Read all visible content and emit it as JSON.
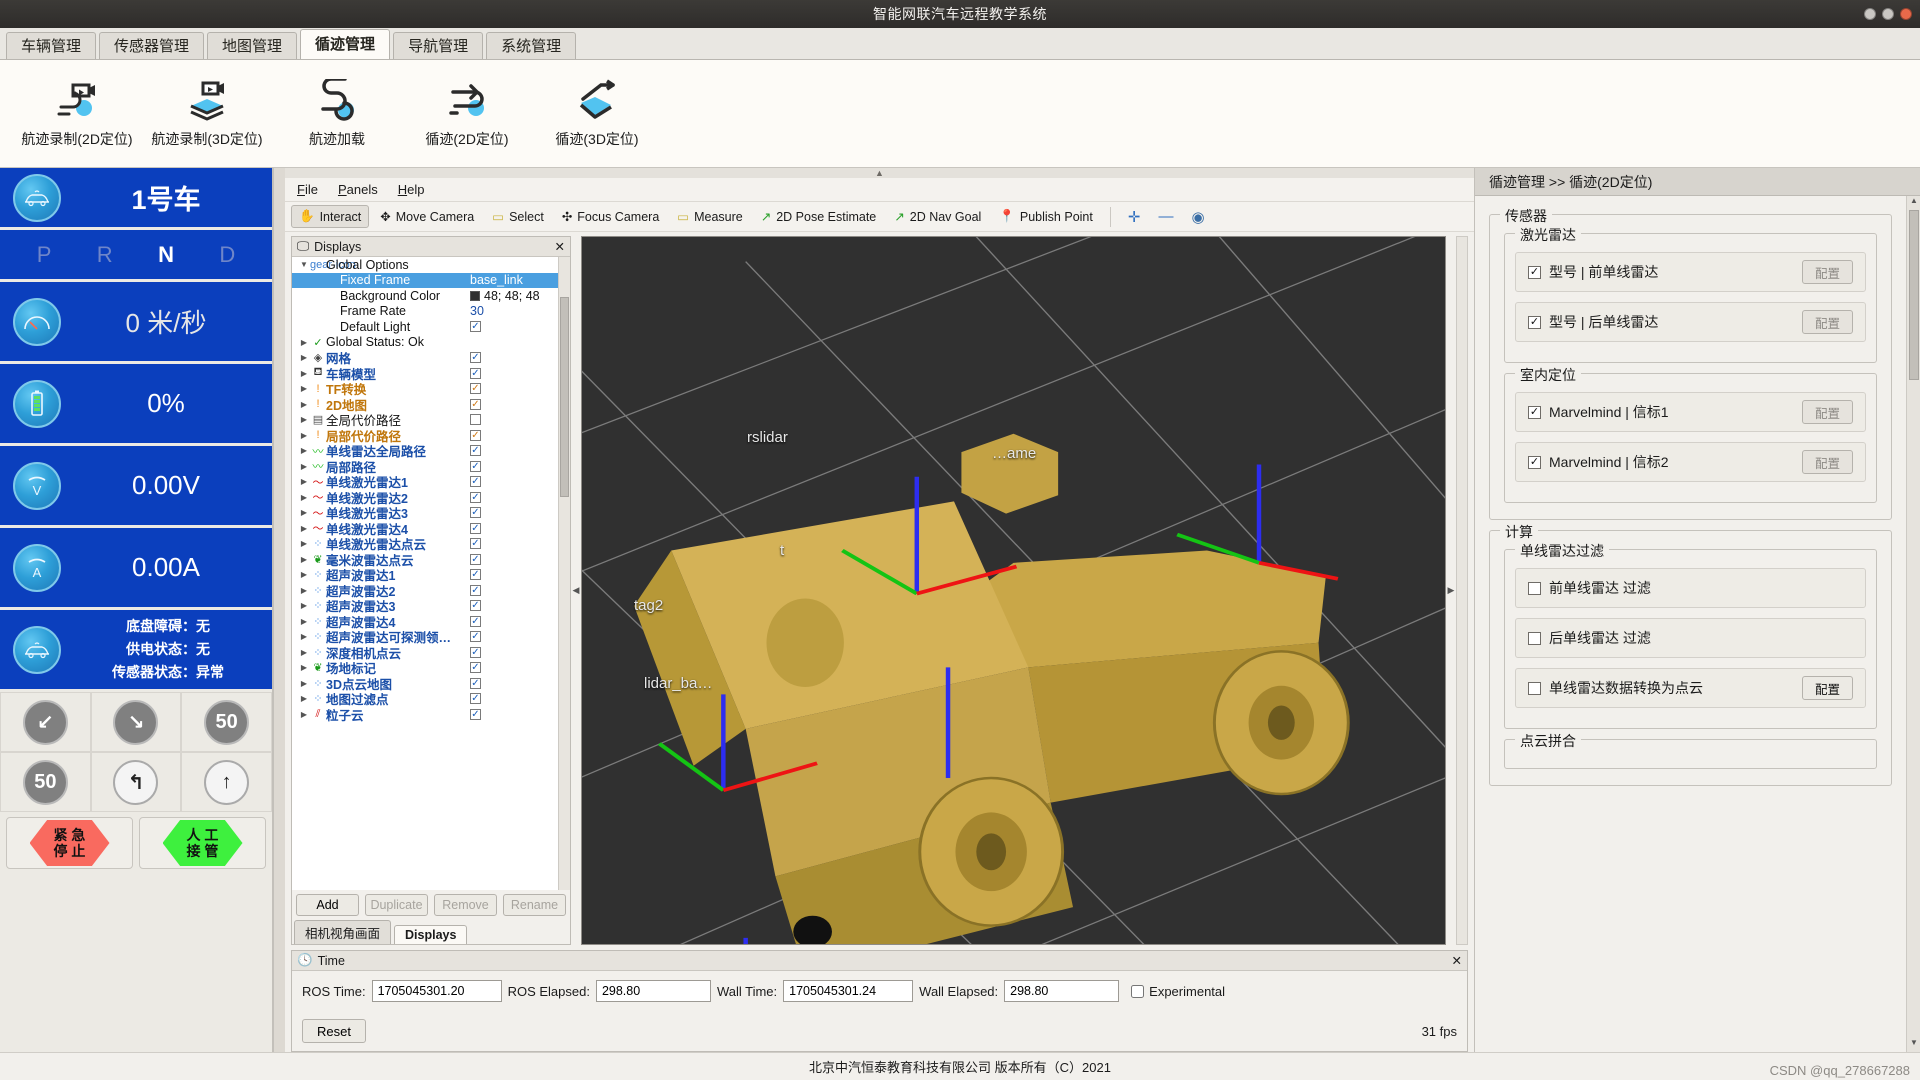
{
  "window": {
    "title": "智能网联汽车远程教学系统"
  },
  "tabs": [
    {
      "label": "车辆管理",
      "active": false
    },
    {
      "label": "传感器管理",
      "active": false
    },
    {
      "label": "地图管理",
      "active": false
    },
    {
      "label": "循迹管理",
      "active": true
    },
    {
      "label": "导航管理",
      "active": false
    },
    {
      "label": "系统管理",
      "active": false
    }
  ],
  "ribbon": [
    {
      "label": "航迹录制(2D定位)",
      "icon": "route-record-2d-icon"
    },
    {
      "label": "航迹录制(3D定位)",
      "icon": "route-record-3d-icon"
    },
    {
      "label": "航迹加载",
      "icon": "route-load-icon"
    },
    {
      "label": "循迹(2D定位)",
      "icon": "track-follow-2d-icon"
    },
    {
      "label": "循迹(3D定位)",
      "icon": "track-follow-3d-icon"
    }
  ],
  "vehicle": {
    "name": "1号车",
    "gears": [
      "P",
      "R",
      "N",
      "D"
    ],
    "active_gear": "N",
    "speed": "0 米/秒",
    "battery": "0%",
    "voltage": "0.00V",
    "current": "0.00A",
    "status": [
      "底盘障碍：无",
      "供电状态：无",
      "传感器状态：异常"
    ],
    "signs": [
      {
        "name": "turn-left-down-sign",
        "kind": "grey",
        "glyph": "↙"
      },
      {
        "name": "turn-right-down-sign",
        "kind": "grey",
        "glyph": "↘"
      },
      {
        "name": "speed-limit-50-sign",
        "kind": "grey",
        "glyph": "50"
      },
      {
        "name": "speed-limit-50-white-sign",
        "kind": "grey",
        "glyph": "50"
      },
      {
        "name": "no-left-turn-sign",
        "kind": "white",
        "glyph": "↰"
      },
      {
        "name": "straight-only-sign",
        "kind": "white",
        "glyph": "↑"
      }
    ],
    "emergency_stop": "紧急停止",
    "manual_takeover": "人工接管"
  },
  "rviz": {
    "menu": [
      "File",
      "Panels",
      "Help"
    ],
    "tools": [
      {
        "label": "Interact",
        "icon": "hand-icon",
        "active": true
      },
      {
        "label": "Move Camera",
        "icon": "move-camera-icon",
        "active": false
      },
      {
        "label": "Select",
        "icon": "select-icon",
        "active": false
      },
      {
        "label": "Focus Camera",
        "icon": "focus-camera-icon",
        "active": false
      },
      {
        "label": "Measure",
        "icon": "measure-icon",
        "active": false
      },
      {
        "label": "2D Pose Estimate",
        "icon": "pose-estimate-icon",
        "active": false
      },
      {
        "label": "2D Nav Goal",
        "icon": "nav-goal-icon",
        "active": false
      },
      {
        "label": "Publish Point",
        "icon": "publish-point-icon",
        "active": false
      }
    ],
    "tool_extras": [
      {
        "name": "add-tool-icon",
        "glyph": "✛"
      },
      {
        "name": "remove-tool-icon",
        "glyph": "—"
      },
      {
        "name": "visibility-icon",
        "glyph": "◉"
      }
    ],
    "displays_title": "Displays",
    "tree": [
      {
        "indent": 0,
        "arrow": "▼",
        "icon": "gear-icon",
        "iconcolor": "#3b7fd0",
        "label": "Global Options",
        "style": "black",
        "value": "",
        "check": null
      },
      {
        "indent": 1,
        "arrow": "",
        "icon": "",
        "iconcolor": "",
        "label": "Fixed Frame",
        "style": "sel",
        "value": "base_link",
        "check": null
      },
      {
        "indent": 1,
        "arrow": "",
        "icon": "",
        "iconcolor": "",
        "label": "Background Color",
        "style": "black",
        "value": "48; 48; 48",
        "check": null,
        "swatch": "#303030"
      },
      {
        "indent": 1,
        "arrow": "",
        "icon": "",
        "iconcolor": "",
        "label": "Frame Rate",
        "style": "black",
        "value": "30",
        "check": null
      },
      {
        "indent": 1,
        "arrow": "",
        "icon": "",
        "iconcolor": "",
        "label": "Default Light",
        "style": "black",
        "value": "",
        "check": "blue"
      },
      {
        "indent": 0,
        "arrow": "▶",
        "icon": "✓",
        "iconcolor": "#1a9a1a",
        "label": "Global Status: Ok",
        "style": "black",
        "value": "",
        "check": null
      },
      {
        "indent": 0,
        "arrow": "▶",
        "icon": "◈",
        "iconcolor": "#444",
        "label": "网格",
        "style": "blue",
        "value": "",
        "check": "blue"
      },
      {
        "indent": 0,
        "arrow": "▶",
        "icon": "⛾",
        "iconcolor": "#333",
        "label": "车辆模型",
        "style": "blue",
        "value": "",
        "check": "blue"
      },
      {
        "indent": 0,
        "arrow": "▶",
        "icon": "!",
        "iconcolor": "#f08c1a",
        "label": "TF转换",
        "style": "orange",
        "value": "",
        "check": "orange"
      },
      {
        "indent": 0,
        "arrow": "▶",
        "icon": "!",
        "iconcolor": "#f08c1a",
        "label": "2D地图",
        "style": "orange",
        "value": "",
        "check": "orange"
      },
      {
        "indent": 0,
        "arrow": "▶",
        "icon": "▤",
        "iconcolor": "#555",
        "label": "全局代价路径",
        "style": "black",
        "value": "",
        "check": "empty"
      },
      {
        "indent": 0,
        "arrow": "▶",
        "icon": "!",
        "iconcolor": "#f08c1a",
        "label": "局部代价路径",
        "style": "orange",
        "value": "",
        "check": "orange"
      },
      {
        "indent": 0,
        "arrow": "▶",
        "icon": "〰",
        "iconcolor": "#12b512",
        "label": "单线雷达全局路径",
        "style": "blue",
        "value": "",
        "check": "blue"
      },
      {
        "indent": 0,
        "arrow": "▶",
        "icon": "〰",
        "iconcolor": "#12b512",
        "label": "局部路径",
        "style": "blue",
        "value": "",
        "check": "blue"
      },
      {
        "indent": 0,
        "arrow": "▶",
        "icon": "〜",
        "iconcolor": "#d41111",
        "label": "单线激光雷达1",
        "style": "blue",
        "value": "",
        "check": "blue"
      },
      {
        "indent": 0,
        "arrow": "▶",
        "icon": "〜",
        "iconcolor": "#d41111",
        "label": "单线激光雷达2",
        "style": "blue",
        "value": "",
        "check": "blue"
      },
      {
        "indent": 0,
        "arrow": "▶",
        "icon": "〜",
        "iconcolor": "#d41111",
        "label": "单线激光雷达3",
        "style": "blue",
        "value": "",
        "check": "blue"
      },
      {
        "indent": 0,
        "arrow": "▶",
        "icon": "〜",
        "iconcolor": "#d41111",
        "label": "单线激光雷达4",
        "style": "blue",
        "value": "",
        "check": "blue"
      },
      {
        "indent": 0,
        "arrow": "▶",
        "icon": "⁘",
        "iconcolor": "#2f7fe0",
        "label": "单线激光雷达点云",
        "style": "blue",
        "value": "",
        "check": "blue"
      },
      {
        "indent": 0,
        "arrow": "▶",
        "icon": "❦",
        "iconcolor": "#1a9a1a",
        "label": "毫米波雷达点云",
        "style": "blue",
        "value": "",
        "check": "blue"
      },
      {
        "indent": 0,
        "arrow": "▶",
        "icon": "⁘",
        "iconcolor": "#2f7fe0",
        "label": "超声波雷达1",
        "style": "blue",
        "value": "",
        "check": "blue"
      },
      {
        "indent": 0,
        "arrow": "▶",
        "icon": "⁘",
        "iconcolor": "#2f7fe0",
        "label": "超声波雷达2",
        "style": "blue",
        "value": "",
        "check": "blue"
      },
      {
        "indent": 0,
        "arrow": "▶",
        "icon": "⁘",
        "iconcolor": "#2f7fe0",
        "label": "超声波雷达3",
        "style": "blue",
        "value": "",
        "check": "blue"
      },
      {
        "indent": 0,
        "arrow": "▶",
        "icon": "⁘",
        "iconcolor": "#2f7fe0",
        "label": "超声波雷达4",
        "style": "blue",
        "value": "",
        "check": "blue"
      },
      {
        "indent": 0,
        "arrow": "▶",
        "icon": "⁘",
        "iconcolor": "#2f7fe0",
        "label": "超声波雷达可探测领…",
        "style": "blue",
        "value": "",
        "check": "blue"
      },
      {
        "indent": 0,
        "arrow": "▶",
        "icon": "⁘",
        "iconcolor": "#2f7fe0",
        "label": "深度相机点云",
        "style": "blue",
        "value": "",
        "check": "blue"
      },
      {
        "indent": 0,
        "arrow": "▶",
        "icon": "❦",
        "iconcolor": "#1a9a1a",
        "label": "场地标记",
        "style": "blue",
        "value": "",
        "check": "blue"
      },
      {
        "indent": 0,
        "arrow": "▶",
        "icon": "⁘",
        "iconcolor": "#2f7fe0",
        "label": "3D点云地图",
        "style": "blue",
        "value": "",
        "check": "blue"
      },
      {
        "indent": 0,
        "arrow": "▶",
        "icon": "⁘",
        "iconcolor": "#2f7fe0",
        "label": "地图过滤点",
        "style": "blue",
        "value": "",
        "check": "blue"
      },
      {
        "indent": 0,
        "arrow": "▶",
        "icon": "⫽",
        "iconcolor": "#d41111",
        "label": "粒子云",
        "style": "blue",
        "value": "",
        "check": "blue"
      }
    ],
    "buttons": {
      "add": "Add",
      "duplicate": "Duplicate",
      "remove": "Remove",
      "rename": "Rename"
    },
    "dock_tabs": [
      {
        "label": "相机视角画面",
        "active": false
      },
      {
        "label": "Displays",
        "active": true
      }
    ],
    "scene_labels": [
      "rslidar",
      "…ame",
      "t",
      "tag2",
      "lidar_ba…"
    ],
    "time": {
      "title": "Time",
      "ros_time_label": "ROS Time:",
      "ros_time_value": "1705045301.20",
      "ros_elapsed_label": "ROS Elapsed:",
      "ros_elapsed_value": "298.80",
      "wall_time_label": "Wall Time:",
      "wall_time_value": "1705045301.24",
      "wall_elapsed_label": "Wall Elapsed:",
      "wall_elapsed_value": "298.80",
      "experimental_label": "Experimental",
      "experimental_checked": false,
      "reset_label": "Reset",
      "fps": "31 fps"
    }
  },
  "right_panel": {
    "title": "循迹管理 >> 循迹(2D定位)",
    "groups": [
      {
        "title": "传感器",
        "subgroups": [
          {
            "title": "激光雷达",
            "items": [
              {
                "label": "型号 | 前单线雷达",
                "checked": true,
                "button": "配置",
                "button_enabled": false
              },
              {
                "label": "型号 | 后单线雷达",
                "checked": true,
                "button": "配置",
                "button_enabled": false
              }
            ]
          },
          {
            "title": "室内定位",
            "items": [
              {
                "label": "Marvelmind | 信标1",
                "checked": true,
                "button": "配置",
                "button_enabled": false
              },
              {
                "label": "Marvelmind | 信标2",
                "checked": true,
                "button": "配置",
                "button_enabled": false
              }
            ]
          }
        ]
      },
      {
        "title": "计算",
        "subgroups": [
          {
            "title": "单线雷达过滤",
            "items": [
              {
                "label": "前单线雷达 过滤",
                "checked": false,
                "button": "",
                "button_enabled": false
              },
              {
                "label": "后单线雷达 过滤",
                "checked": false,
                "button": "",
                "button_enabled": false
              },
              {
                "label": "单线雷达数据转换为点云",
                "checked": false,
                "button": "配置",
                "button_enabled": true
              }
            ]
          },
          {
            "title": "点云拼合",
            "items": []
          }
        ]
      }
    ]
  },
  "footer": {
    "copyright": "北京中汽恒泰教育科技有限公司 版本所有（C）2021",
    "watermark": "CSDN @qq_278667288"
  }
}
